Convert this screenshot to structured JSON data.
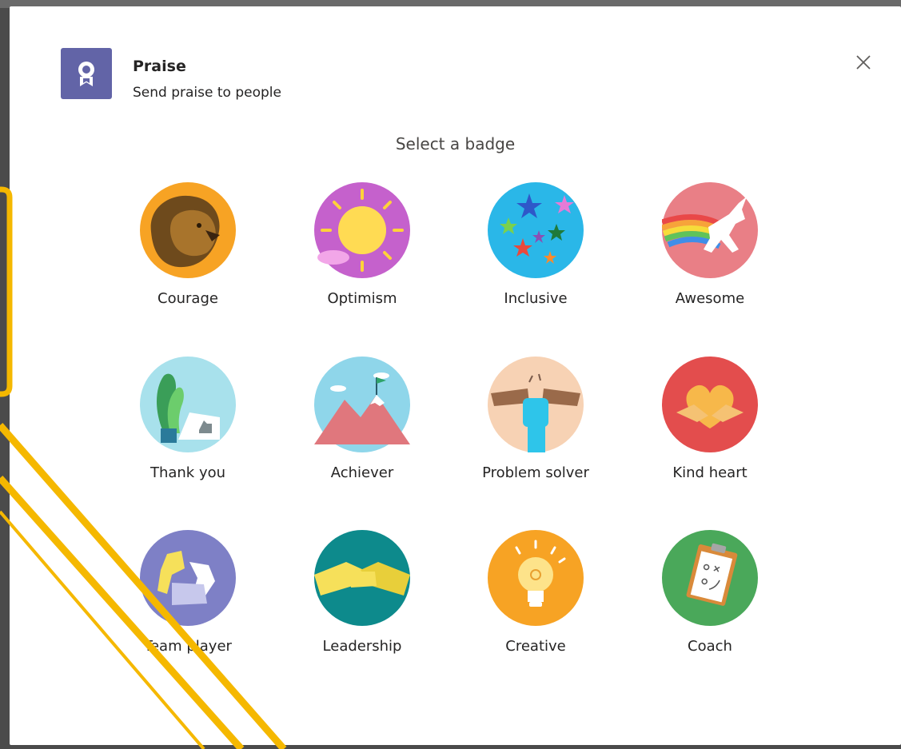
{
  "dialog": {
    "title": "Praise",
    "subtitle": "Send praise to people",
    "prompt": "Select a badge",
    "close_icon": "close-icon",
    "app_icon": "award-ribbon-icon"
  },
  "badges": [
    {
      "label": "Courage",
      "icon": "lion-icon"
    },
    {
      "label": "Optimism",
      "icon": "sun-icon"
    },
    {
      "label": "Inclusive",
      "icon": "stars-icon"
    },
    {
      "label": "Awesome",
      "icon": "unicorn-icon"
    },
    {
      "label": "Thank you",
      "icon": "thank-you-card-icon"
    },
    {
      "label": "Achiever",
      "icon": "mountain-flag-icon"
    },
    {
      "label": "Problem solver",
      "icon": "raised-fist-icon"
    },
    {
      "label": "Kind heart",
      "icon": "heart-hands-icon"
    },
    {
      "label": "Team player",
      "icon": "team-fists-icon"
    },
    {
      "label": "Leadership",
      "icon": "handshake-icon"
    },
    {
      "label": "Creative",
      "icon": "lightbulb-icon"
    },
    {
      "label": "Coach",
      "icon": "clipboard-plan-icon"
    }
  ],
  "colors": {
    "brand": "#6264a7",
    "annotation": "#f5b800",
    "backdrop": "#4b4b4b"
  }
}
